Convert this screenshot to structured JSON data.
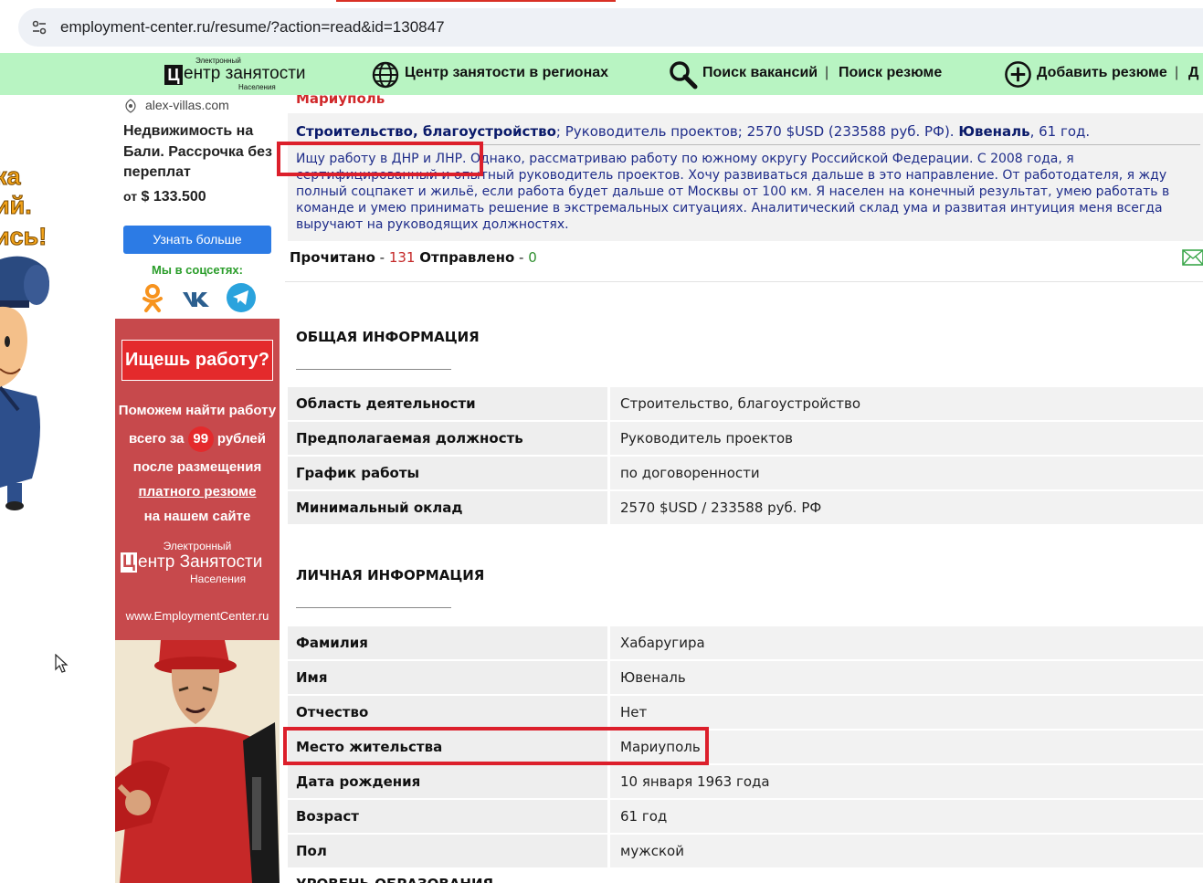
{
  "browser": {
    "url": "employment-center.ru/resume/?action=read&id=130847"
  },
  "nav": {
    "logo_small_top": "Электронный",
    "logo_letter": "Ц",
    "logo_big": "ентр занятости",
    "logo_small_bottom": "Населения",
    "regions": "Центр занятости в регионах",
    "search_vacancies": "Поиск вакансий",
    "separator": "|",
    "search_resumes": "Поиск резюме",
    "add_resume": "Добавить резюме",
    "separator2": "|",
    "cut_item": "Д"
  },
  "left_banner": {
    "line1": "ка",
    "line2": "ий.",
    "line3": "ись!"
  },
  "ad": {
    "source": "alex-villas.com",
    "title": "Недвижимость на Бали. Рассрочка без переплат",
    "price_prefix": "от",
    "price": "$ 133.500",
    "button": "Узнать больше",
    "social_label": "Мы в соцсетях:",
    "social_icons": [
      "odnoklassniki-icon",
      "vk-icon",
      "telegram-icon"
    ]
  },
  "promo": {
    "headline": "Ищешь работу?",
    "line1": "Поможем найти работу",
    "line2_pre": "всего за",
    "line2_price": "99",
    "line2_post": "рублей",
    "line3": "после размещения",
    "line4": "платного резюме",
    "line5": "на нашем сайте",
    "logo_small": "Электронный",
    "logo_letter": "Ц",
    "logo_big": "ентр Занятости",
    "logo_bottom": "Населения",
    "url": "www.EmploymentCenter.ru"
  },
  "resume": {
    "city_header": "Мариуполь",
    "summary": {
      "sphere": "Строительство, благоустройство",
      "sep1": ";",
      "position": "Руководитель проектов",
      "sep2": ";",
      "salary": "2570 $USD (233588 руб. РФ).",
      "name": "Ювеналь",
      "age": ", 61 год.",
      "description": "Ищу работу в ДНР и ЛНР. Однако, рассматриваю работу по южному округу Российской Федерации. С 2008 года, я сертифицированный и опытный руководитель проектов. Хочу развиваться дальше в это направление. От работодателя, я жду полный соцпакет и жильё, если работа будет дальше от Москвы от 100 км. Я населен на конечный результат, умею работать в команде и умею принимать решение в экстремальных ситуациях. Аналитический склад ума и развитая интуиция меня всегда выручают на руководящих должностях."
    },
    "stats": {
      "read_label": "Прочитано",
      "dash1": " - ",
      "read_count": "131",
      "sent_label": "Отправлено",
      "dash2": " - ",
      "sent_count": "0"
    },
    "general": {
      "title": "ОБЩАЯ ИНФОРМАЦИЯ",
      "rows": [
        {
          "label": "Область деятельности",
          "value": "Строительство, благоустройство"
        },
        {
          "label": "Предполагаемая должность",
          "value": "Руководитель проектов"
        },
        {
          "label": "График работы",
          "value": "по договоренности"
        },
        {
          "label": "Минимальный оклад",
          "value": "2570 $USD / 233588 руб. РФ"
        }
      ]
    },
    "personal": {
      "title": "ЛИЧНАЯ ИНФОРМАЦИЯ",
      "rows": [
        {
          "label": "Фамилия",
          "value": "Хабаругира"
        },
        {
          "label": "Имя",
          "value": "Ювеналь"
        },
        {
          "label": "Отчество",
          "value": "Нет"
        },
        {
          "label": "Место жительства",
          "value": "Мариуполь"
        },
        {
          "label": "Дата рождения",
          "value": "10 января 1963 года"
        },
        {
          "label": "Возраст",
          "value": "61 год"
        },
        {
          "label": "Пол",
          "value": "мужской"
        }
      ]
    },
    "next_section_title": "УРОВЕНЬ ОБРАЗОВАНИЯ"
  },
  "colors": {
    "nav_bg": "#b8f4c2",
    "highlight": "#dc1f2b",
    "summary_text": "#1f2d8a",
    "city": "#d0282a"
  }
}
